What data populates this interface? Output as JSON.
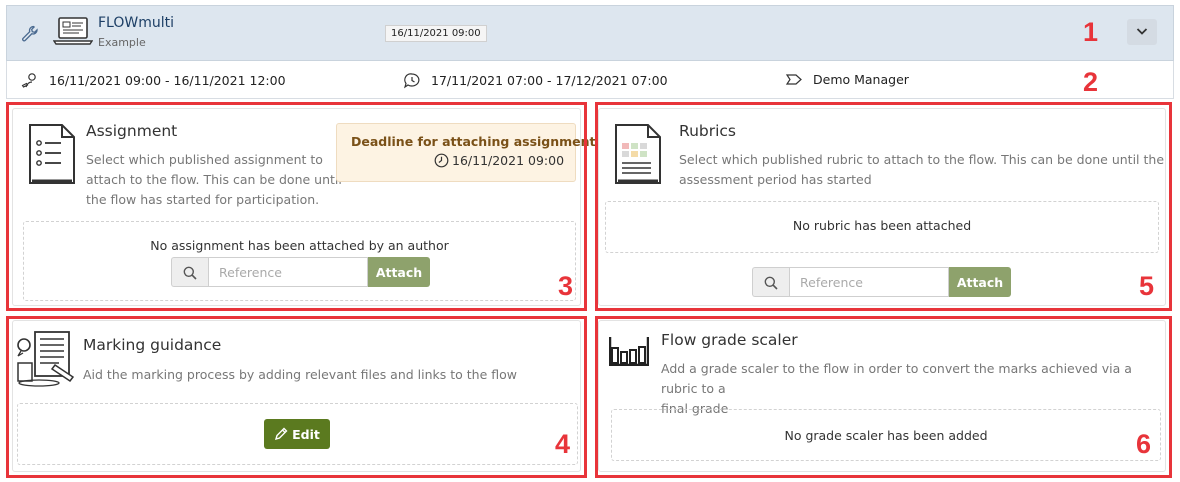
{
  "header": {
    "flow_name": "FLOWmulti",
    "subtitle": "Example",
    "date_chip": "16/11/2021 09:00"
  },
  "meta": {
    "participation": "16/11/2021 09:00 - 16/11/2021 12:00",
    "assessment": "17/11/2021 07:00 - 17/12/2021 07:00",
    "manager": "Demo Manager"
  },
  "assignment": {
    "title": "Assignment",
    "desc": [
      "Select which published assignment to",
      "attach to the flow. This can be done until",
      "the flow has started for participation."
    ],
    "deadline_title": "Deadline for attaching assignment",
    "deadline_date": "16/11/2021 09:00",
    "empty": "No assignment has been attached by an author",
    "placeholder": "Reference",
    "attach": "Attach"
  },
  "rubrics": {
    "title": "Rubrics",
    "desc": [
      "Select which published rubric to attach to the flow. This can be done until the",
      "assessment period has started"
    ],
    "empty": "No rubric has been attached",
    "placeholder": "Reference",
    "attach": "Attach"
  },
  "guidance": {
    "title": "Marking guidance",
    "desc": "Aid the marking process by adding relevant files and links to the flow",
    "edit": "Edit"
  },
  "scaler": {
    "title": "Flow grade scaler",
    "desc": [
      "Add a grade scaler to the flow in order to convert the marks achieved via a rubric to a",
      "final grade"
    ],
    "empty": "No grade scaler has been added"
  },
  "callouts": [
    "1",
    "2",
    "3",
    "4",
    "5",
    "6"
  ],
  "colors": {
    "highlight": "#e8343a",
    "attach": "#8ea26c",
    "edit": "#5b7a1f",
    "header_bg": "#dde6ef"
  },
  "icons": [
    "wrench-icon",
    "laptop-icon",
    "chevron-down-icon",
    "participation-icon",
    "clock-comment-icon",
    "manager-icon",
    "assignment-doc-icon",
    "rubric-doc-icon",
    "guidance-icon",
    "grade-scaler-icon",
    "search-icon",
    "clock-icon",
    "pencil-icon"
  ]
}
